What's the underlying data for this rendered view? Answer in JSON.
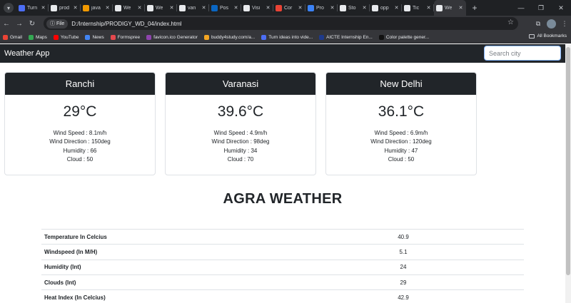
{
  "browser": {
    "tabs": [
      {
        "title": "Turn",
        "favicon_color": "#4c6ef5",
        "active": false
      },
      {
        "title": "prod",
        "favicon_color": "#e8eaed",
        "active": false
      },
      {
        "title": "java",
        "favicon_color": "#f29900",
        "active": false
      },
      {
        "title": "We",
        "favicon_color": "#e8eaed",
        "active": false
      },
      {
        "title": "We",
        "favicon_color": "#e8eaed",
        "active": false
      },
      {
        "title": "van",
        "favicon_color": "#e8eaed",
        "active": false
      },
      {
        "title": "Pos",
        "favicon_color": "#0a66c2",
        "active": false
      },
      {
        "title": "Visi",
        "favicon_color": "#e8eaed",
        "active": false
      },
      {
        "title": "Cor",
        "favicon_color": "#ea4335",
        "active": false
      },
      {
        "title": "Pro",
        "favicon_color": "#3b82f6",
        "active": false
      },
      {
        "title": "Sto",
        "favicon_color": "#e8eaed",
        "active": false
      },
      {
        "title": "opp",
        "favicon_color": "#e8eaed",
        "active": false
      },
      {
        "title": "Tic",
        "favicon_color": "#e8eaed",
        "active": false
      },
      {
        "title": "We",
        "favicon_color": "#e8eaed",
        "active": true
      }
    ],
    "chip_label": "File",
    "url": "D:/Internship/PRODIGY_WD_04/index.html",
    "bookmarks": [
      {
        "label": "Gmail",
        "color": "#ea4335"
      },
      {
        "label": "Maps",
        "color": "#34a853"
      },
      {
        "label": "YouTube",
        "color": "#ff0000"
      },
      {
        "label": "News",
        "color": "#4285f4"
      },
      {
        "label": "Formspree",
        "color": "#e5484d"
      },
      {
        "label": "favicon.ico Generator",
        "color": "#8e44ad"
      },
      {
        "label": "buddy4study.com/a...",
        "color": "#f5a623"
      },
      {
        "label": "Turn ideas into vide...",
        "color": "#4c6ef5"
      },
      {
        "label": "AICTE Internship En...",
        "color": "#1e3a8a"
      },
      {
        "label": "Color palette gener...",
        "color": "#111111"
      }
    ],
    "all_bookmarks_label": "All Bookmarks"
  },
  "app": {
    "brand": "Weather App",
    "search_placeholder": "Search city"
  },
  "cities": [
    {
      "name": "Ranchi",
      "temp": "29°C",
      "wind_speed": "Wind Speed : 8.1m/h",
      "wind_direction": "Wind Direction : 150deg",
      "humidity": "Humidity : 66",
      "cloud": "Cloud : 50"
    },
    {
      "name": "Varanasi",
      "temp": "39.6°C",
      "wind_speed": "Wind Speed : 4.9m/h",
      "wind_direction": "Wind Direction : 98deg",
      "humidity": "Humidity : 34",
      "cloud": "Cloud : 70"
    },
    {
      "name": "New Delhi",
      "temp": "36.1°C",
      "wind_speed": "Wind Speed : 6.9m/h",
      "wind_direction": "Wind Direction : 120deg",
      "humidity": "Humidity : 47",
      "cloud": "Cloud : 50"
    }
  ],
  "detail": {
    "title": "AGRA WEATHER",
    "rows": [
      {
        "label": "Temperature In Celcius",
        "value": "40.9"
      },
      {
        "label": "Windspeed (In M/H)",
        "value": "5.1"
      },
      {
        "label": "Humidity (Int)",
        "value": "24"
      },
      {
        "label": "Clouds (Int)",
        "value": "29"
      },
      {
        "label": "Heat Index (In Celcius)",
        "value": "42.9"
      }
    ]
  }
}
